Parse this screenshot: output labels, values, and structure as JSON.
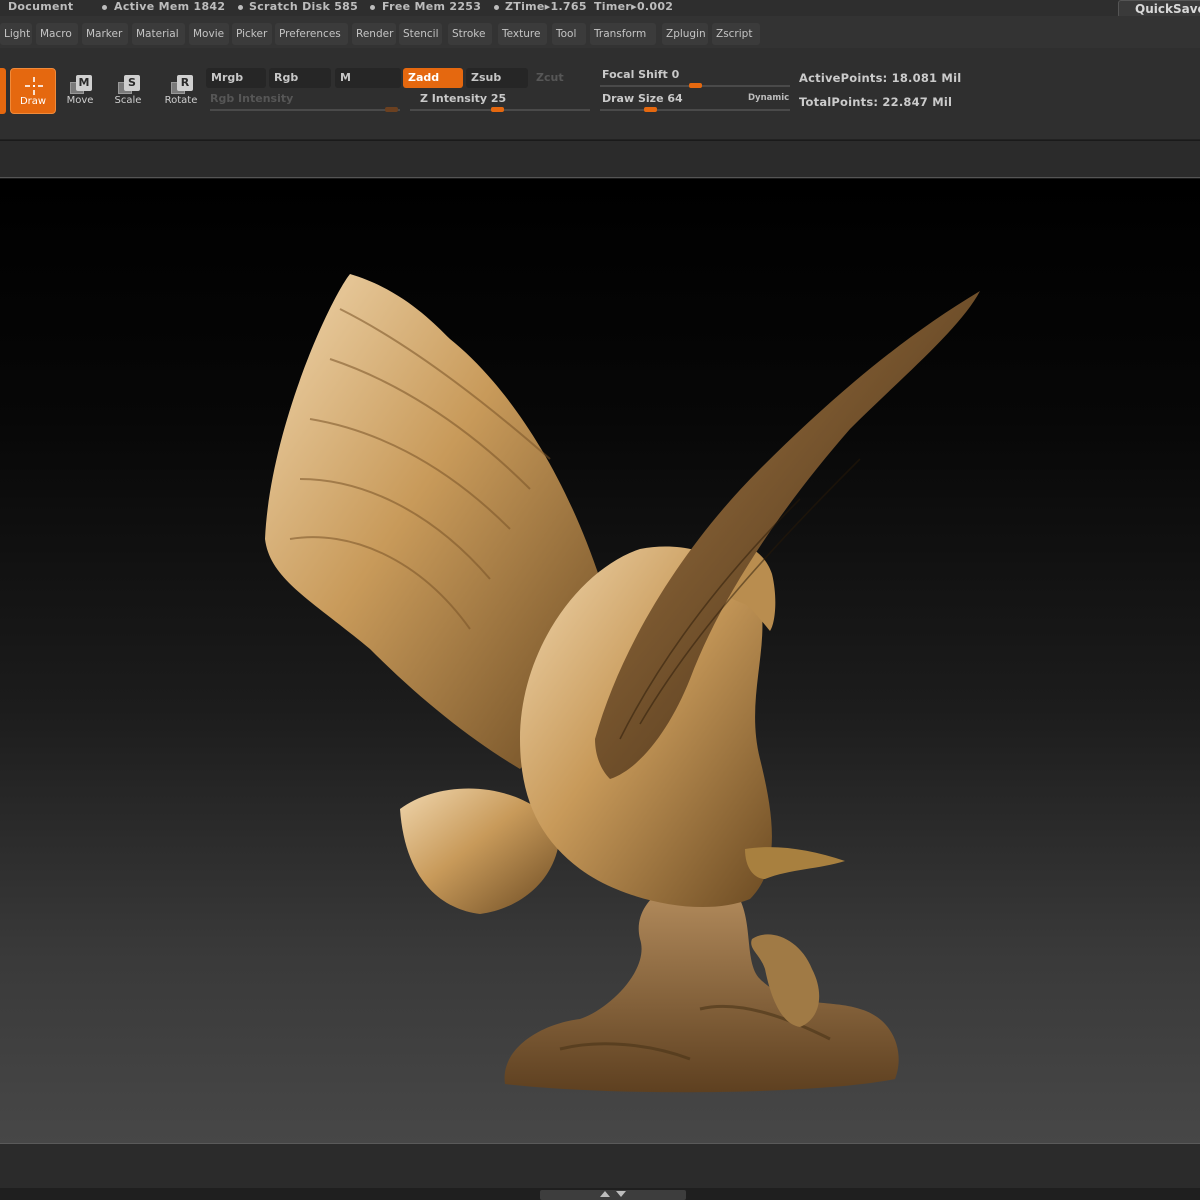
{
  "status": {
    "document_label": "Document",
    "active_mem": "Active Mem 1842",
    "scratch_disk": "Scratch Disk 585",
    "free_mem": "Free Mem 2253",
    "ztime": "ZTime▸1.765",
    "timer": "Timer▸0.002",
    "quicksave_label": "QuickSave"
  },
  "menu": {
    "items": [
      "Light",
      "Macro",
      "Marker",
      "Material",
      "Movie",
      "Picker",
      "Preferences",
      "Render",
      "Stencil",
      "Stroke",
      "Texture",
      "Tool",
      "Transform",
      "Zplugin",
      "Zscript"
    ]
  },
  "tools": {
    "draw": {
      "label": "Draw",
      "icon": "draw-crosshair-icon"
    },
    "move": {
      "label": "Move",
      "key": "M",
      "icon": "move-key-icon"
    },
    "scale": {
      "label": "Scale",
      "key": "S",
      "icon": "scale-key-icon"
    },
    "rotate": {
      "label": "Rotate",
      "key": "R",
      "icon": "rotate-key-icon"
    }
  },
  "modes": {
    "mrgb": "Mrgb",
    "rgb": "Rgb",
    "m": "M",
    "zadd": "Zadd",
    "zsub": "Zsub",
    "zcut": "Zcut",
    "active_mode": "Zadd"
  },
  "sliders": {
    "rgb_intensity": {
      "label": "Rgb Intensity",
      "enabled": false
    },
    "z_intensity": {
      "label": "Z Intensity 25",
      "value": 25
    },
    "focal_shift": {
      "label": "Focal Shift 0",
      "value": 0
    },
    "draw_size": {
      "label": "Draw Size 64",
      "value": 64
    },
    "dynamic_label": "Dynamic"
  },
  "stats": {
    "active_points": "ActivePoints: 18.081 Mil",
    "total_points": "TotalPoints: 22.847 Mil"
  },
  "colors": {
    "accent": "#e5680f",
    "panel": "#2f2f2f",
    "model_bronze": "#b98d4f"
  },
  "canvas": {
    "subject": "bronze-eagle-sculpture"
  }
}
